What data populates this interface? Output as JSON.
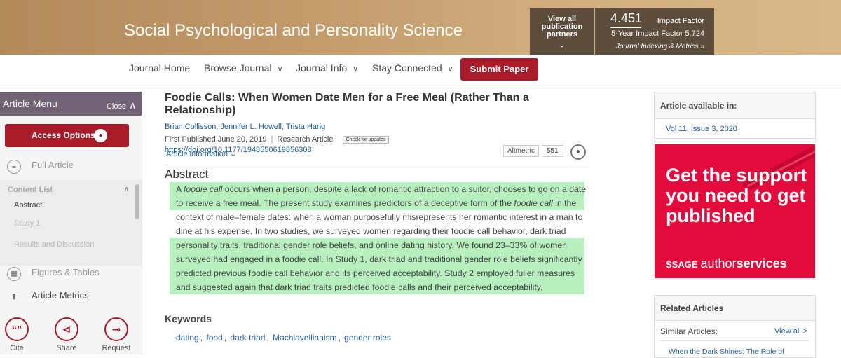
{
  "header": {
    "journal_title": "Social Psychological and Personality Science",
    "partners_label": "View all publication partners",
    "impact_value": "4.451",
    "impact_label": "Impact Factor",
    "five_year": "5-Year Impact Factor 5.724",
    "indexing": "Journal Indexing & Metrics »"
  },
  "nav": {
    "items": [
      "Journal Home",
      "Browse Journal",
      "Journal Info",
      "Stay Connected"
    ],
    "submit": "Submit Paper"
  },
  "left_menu": {
    "title": "Article Menu",
    "close": "Close",
    "access": "Access Options",
    "full_article": "Full Article",
    "content_list_title": "Content List",
    "content_items": [
      "Abstract",
      "Study 1",
      "Results and Discussion"
    ],
    "figures": "Figures & Tables",
    "metrics": "Article Metrics",
    "actions": [
      "Cite",
      "Share",
      "Request"
    ]
  },
  "article": {
    "title": "Foodie Calls: When Women Date Men for a Free Meal (Rather Than a Relationship)",
    "authors": "Brian Collisson, Jennifer L. Howell, Trista Harig",
    "first_published": "First Published June 20, 2019",
    "type": "Research Article",
    "check_updates": "Check for updates",
    "doi": "https://doi.org/10.1177/1948550619856308",
    "article_info": "Article information",
    "altmetric_label": "Altmetric",
    "altmetric_count": "551",
    "abstract_heading": "Abstract",
    "abstract_lines": [
      {
        "pre": "A ",
        "em": "foodie call",
        "post": " occurs when a person, despite a lack of romantic attraction to a suitor, chooses to go on a date",
        "hl": true
      },
      {
        "pre": "to receive a free meal. The present study examines predictors of a deceptive form of the ",
        "em": "foodie call",
        "post": " in the",
        "hl": true
      },
      {
        "pre": "context of male–female dates: when a woman purposefully misrepresents her romantic interest in a man to",
        "em": "",
        "post": "",
        "hl": false
      },
      {
        "pre": "dine at his expense. In two studies, we surveyed women regarding their foodie call behavior, dark triad",
        "em": "",
        "post": "",
        "hl": false
      },
      {
        "pre": "personality traits, traditional gender role beliefs, and online dating history. We found 23–33% of women",
        "em": "",
        "post": "",
        "hl": true
      },
      {
        "pre": "surveyed had engaged in a foodie call. In Study 1, dark triad and traditional gender role beliefs significantly",
        "em": "",
        "post": "",
        "hl": true
      },
      {
        "pre": "predicted previous foodie call behavior and its perceived acceptability. Study 2 employed fuller measures",
        "em": "",
        "post": "",
        "hl": true
      },
      {
        "pre": "and suggested again that dark triad traits predicted foodie calls and their perceived acceptability.",
        "em": "",
        "post": "",
        "hl": true
      }
    ],
    "keywords_heading": "Keywords",
    "keywords": [
      "dating",
      "food",
      "dark triad",
      "Machiavellianism",
      "gender roles"
    ]
  },
  "sidebar": {
    "available_heading": "Article available in:",
    "available_value": "Vol 11, Issue 3, 2020",
    "ad_text": "Get the support you need to get published",
    "ad_brand_logo": "SSAGE",
    "ad_brand_pre": "author",
    "ad_brand_bold": "services",
    "related_heading": "Related Articles",
    "similar": "Similar Articles:",
    "view_all": "View all >",
    "first_related": "When the Dark Shines: The Role of"
  },
  "colors": {
    "brand_red": "#a81c2a",
    "menu_purple": "#716276",
    "highlight": "#b7efbe",
    "ad_red": "#e30a3c",
    "banner": "#c29a6a"
  }
}
